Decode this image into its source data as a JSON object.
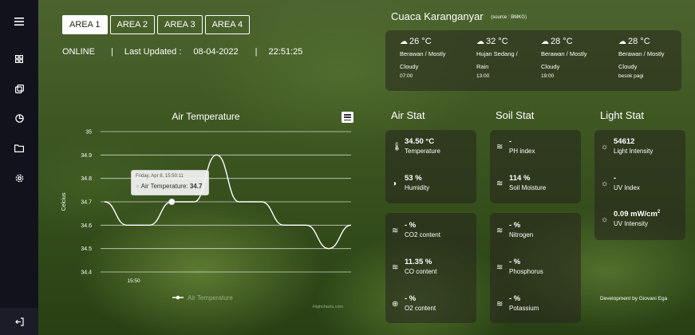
{
  "colors": {
    "sidebar": "#12121c",
    "card": "rgba(40,40,30,0.6)",
    "chart_line": "#ffffff"
  },
  "sidebar": {
    "items": [
      {
        "icon": "menu-icon"
      },
      {
        "icon": "dashboard-icon"
      },
      {
        "icon": "copy-icon"
      },
      {
        "icon": "pie-chart-icon"
      },
      {
        "icon": "folder-icon"
      },
      {
        "icon": "settings-icon"
      }
    ],
    "bottom_icon": "logout-icon"
  },
  "tabs": [
    "AREA 1",
    "AREA 2",
    "AREA 3",
    "AREA 4"
  ],
  "status": {
    "state": "ONLINE",
    "sep": "|",
    "updated_label": "Last Updated :",
    "date": "08-04-2022",
    "time": "22:51:25"
  },
  "chart_data": {
    "type": "line",
    "title": "Air Temperature",
    "ylabel": "Celcius",
    "yticks": [
      "35",
      "34.9",
      "34.8",
      "34.7",
      "34.6",
      "34.5",
      "34.4"
    ],
    "ylim": [
      34.4,
      35.0
    ],
    "xticks": [
      "15:50"
    ],
    "series": [
      {
        "name": "Air Temperature",
        "x": [
          0,
          1,
          2,
          3,
          4,
          5,
          6,
          7,
          8,
          9,
          10,
          11
        ],
        "y": [
          34.7,
          34.6,
          34.6,
          34.7,
          34.7,
          34.9,
          34.7,
          34.7,
          34.6,
          34.6,
          34.5,
          34.6
        ]
      }
    ],
    "tooltip": {
      "date": "Friday, Apr 8, 15:50:11",
      "series_label": "Air Temperature:",
      "value": "34.7"
    },
    "legend": "Air Temperature",
    "credits": "Highcharts.com"
  },
  "weather": {
    "title": "Cuaca Karanganyar",
    "source": "(source : BMKG)",
    "forecasts": [
      {
        "temp": "26 °C",
        "desc1": "Berawan / Mostly",
        "desc2": "Cloudy",
        "time": "07:00"
      },
      {
        "temp": "32 °C",
        "desc1": "Hujan Sedang /",
        "desc2": "Rain",
        "time": "13:00"
      },
      {
        "temp": "28 °C",
        "desc1": "Berawan / Mostly",
        "desc2": "Cloudy",
        "time": "19:00"
      },
      {
        "temp": "28 °C",
        "desc1": "Berawan / Mostly",
        "desc2": "Cloudy",
        "time": "besok pagi"
      }
    ]
  },
  "sections": {
    "air": "Air Stat",
    "soil": "Soil Stat",
    "light": "Light Stat"
  },
  "air_stats": [
    {
      "icon": "thermometer-icon",
      "value": "34.50 °C",
      "label": "Temperature"
    },
    {
      "icon": "humidity-icon",
      "value": "53 %",
      "label": "Humidity"
    }
  ],
  "gas_stats": [
    {
      "icon": "co2-icon",
      "value": "- %",
      "label": "CO2 content"
    },
    {
      "icon": "co-icon",
      "value": "11.35 %",
      "label": "CO content"
    },
    {
      "icon": "o2-icon",
      "value": "- %",
      "label": "O2 content"
    }
  ],
  "soil_stats": [
    {
      "icon": "ph-icon",
      "value": "-",
      "label": "PH index"
    },
    {
      "icon": "soil-moisture-icon",
      "value": "114 %",
      "label": "Soil Moisture"
    }
  ],
  "nutrient_stats": [
    {
      "icon": "nitrogen-icon",
      "value": "- %",
      "label": "Nitrogen"
    },
    {
      "icon": "phosphorus-icon",
      "value": "- %",
      "label": "Phosphorus"
    },
    {
      "icon": "potassium-icon",
      "value": "- %",
      "label": "Potassium"
    }
  ],
  "light_stats": [
    {
      "icon": "sun-icon",
      "value": "54612",
      "label": "Light Intensity"
    },
    {
      "icon": "uv-icon",
      "value": "-",
      "label": "UV Index"
    },
    {
      "icon": "uv-intensity-icon",
      "value": "0.09 mW/cm",
      "value_sup": "2",
      "label": "UV Intensity"
    }
  ],
  "footer": {
    "developer": "Development by Giovani Ega"
  }
}
